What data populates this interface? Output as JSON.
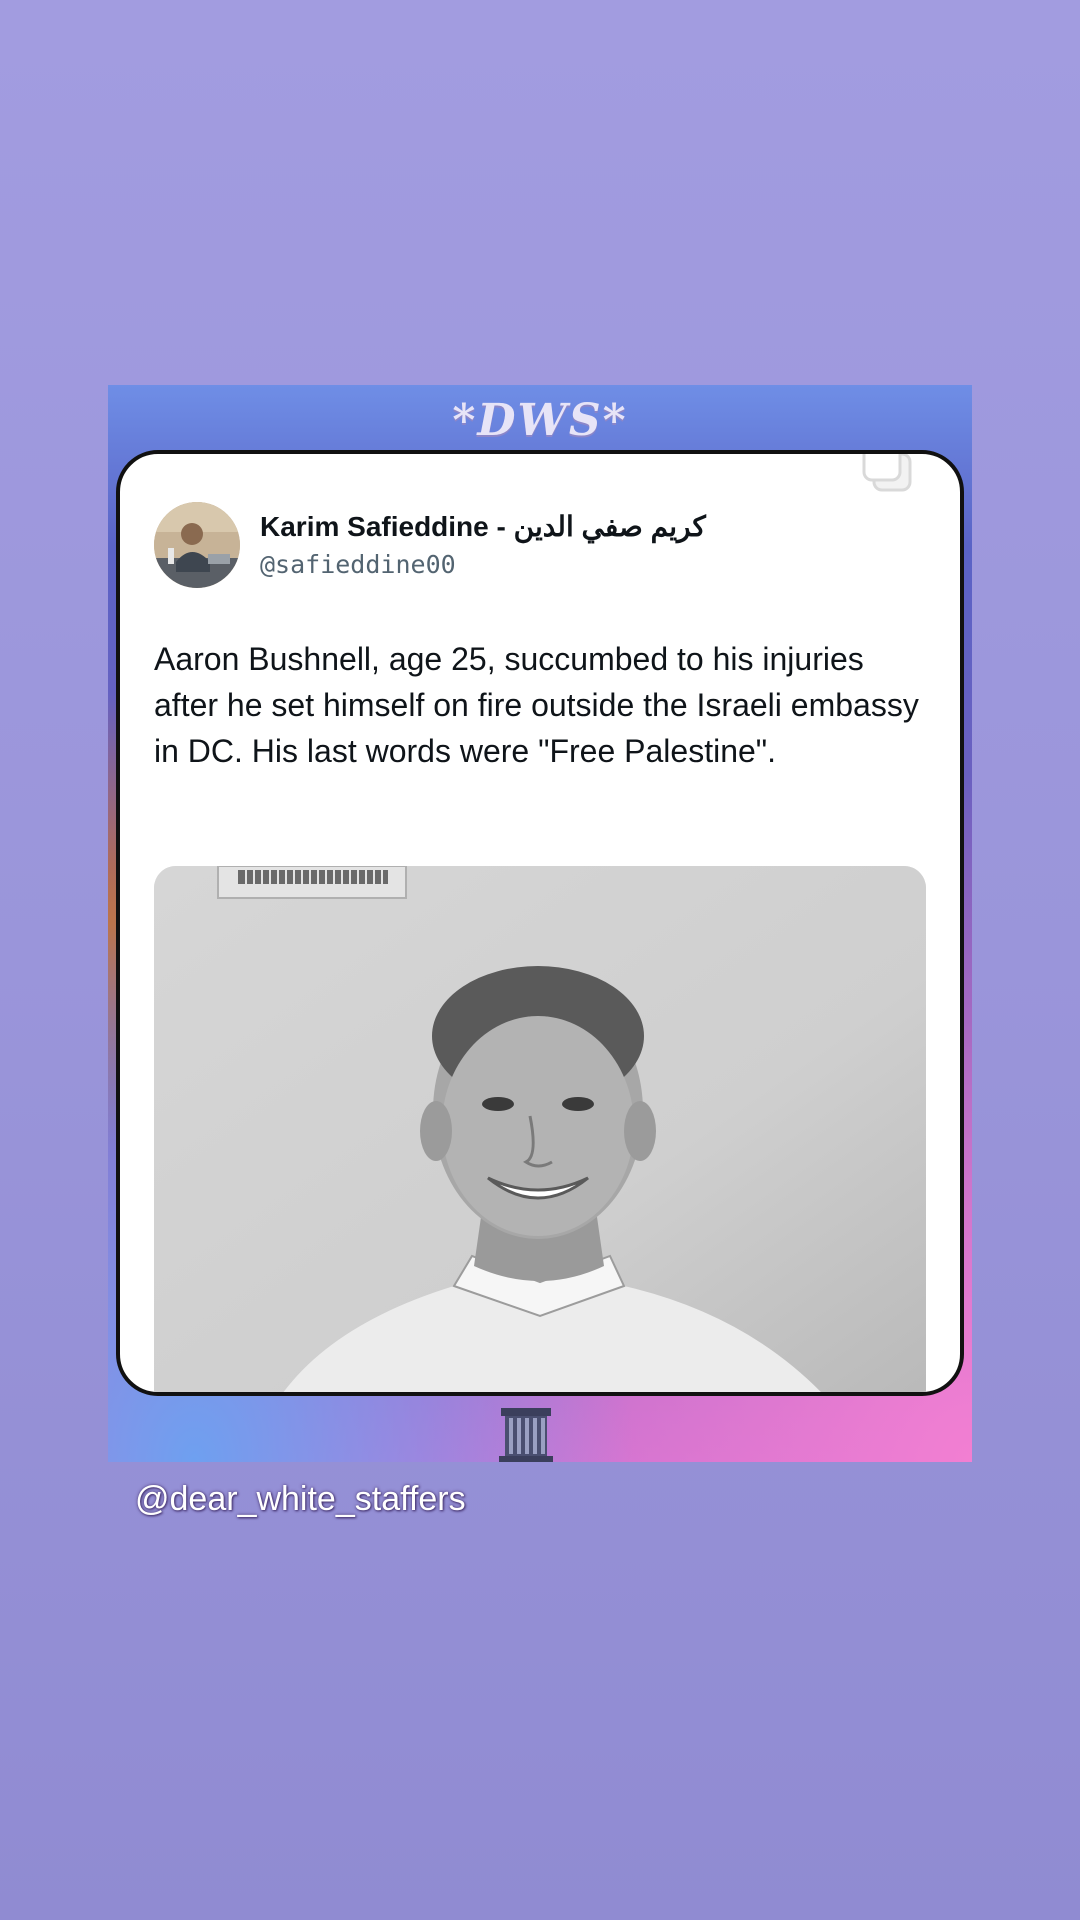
{
  "story": {
    "background_color": "#9f9ade",
    "caption_handle": "@dear_white_staffers"
  },
  "frame": {
    "logo_text": "*DWS*"
  },
  "tweet": {
    "author_name": "Karim Safieddine - كريم صفي الدين",
    "author_handle": "@safieddine00",
    "text": "Aaron Bushnell, age 25, succumbed to his injuries after he set himself on fire outside the Israeli embassy in DC. His last words were \"Free Palestine\".",
    "avatar_icon": "person-avatar",
    "copy_icon": "copy-icon",
    "photo_description_icon": "portrait-photo"
  }
}
